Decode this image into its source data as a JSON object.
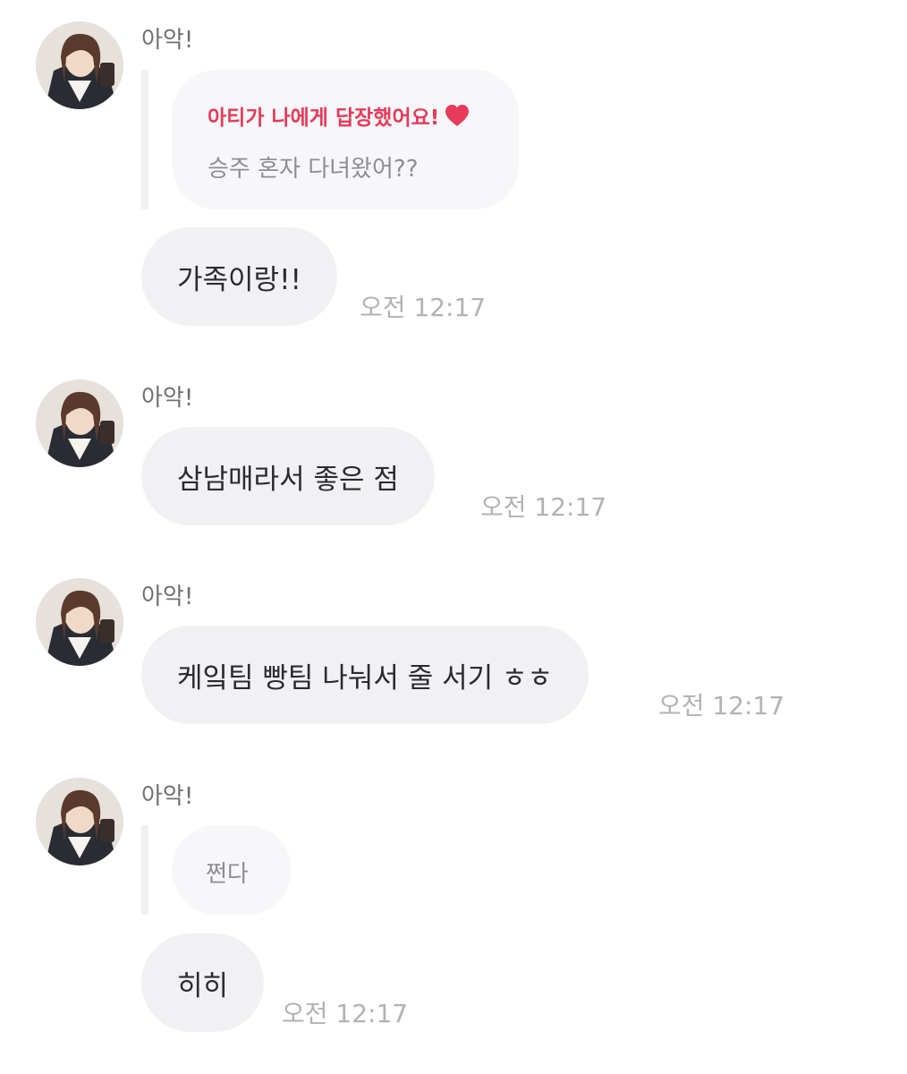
{
  "messages": [
    {
      "sender": "아악!",
      "reply": {
        "title": "아티가 나에게 답장했어요!",
        "heart_icon": "heart-icon",
        "quoted_text": "승주 혼자 다녀왔어??"
      },
      "text": "가족이랑!!",
      "time": "오전 12:17"
    },
    {
      "sender": "아악!",
      "text": "삼남매라서 좋은 점",
      "time": "오전 12:17"
    },
    {
      "sender": "아악!",
      "text": "케잌팀 빵팀 나눠서 줄 서기 ㅎㅎ",
      "time": "오전 12:17"
    },
    {
      "sender": "아악!",
      "reply": {
        "quoted_text": "쩐다"
      },
      "text": "히히",
      "time": "오전 12:17"
    }
  ],
  "colors": {
    "accent": "#e83a5a",
    "bubble": "#f1f1f4",
    "quote_bg": "#f7f7f9",
    "time": "#b2b2b7"
  }
}
